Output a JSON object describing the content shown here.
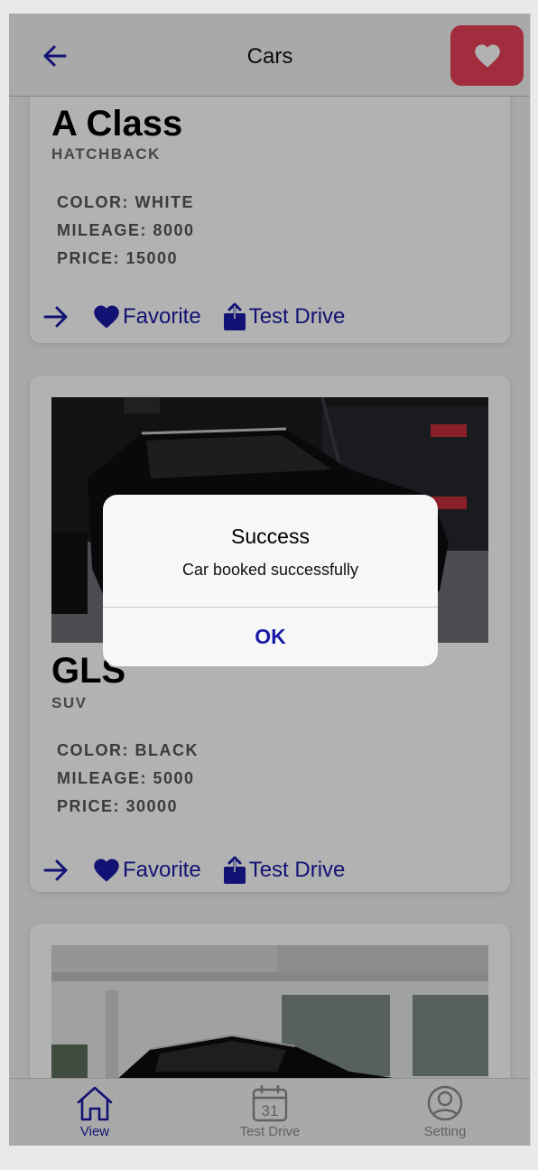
{
  "header": {
    "title": "Cars"
  },
  "cars": [
    {
      "name": "A Class",
      "type": "HATCHBACK",
      "specs": [
        "COLOR: WHITE",
        "MILEAGE: 8000",
        "PRICE: 15000"
      ]
    },
    {
      "name": "GLS",
      "type": "SUV",
      "specs": [
        "COLOR: BLACK",
        "MILEAGE: 5000",
        "PRICE: 30000"
      ]
    }
  ],
  "actions": {
    "favorite": "Favorite",
    "test_drive": "Test Drive"
  },
  "tabs": [
    {
      "label": "View",
      "icon": "home-icon",
      "active": true
    },
    {
      "label": "Test Drive",
      "icon": "calendar-icon",
      "calendar_day": "31",
      "active": false
    },
    {
      "label": "Setting",
      "icon": "profile-icon",
      "active": false
    }
  ],
  "alert": {
    "title": "Success",
    "message": "Car booked successfully",
    "ok_label": "OK"
  },
  "colors": {
    "accent": "#1a1aa6",
    "favorite_button": "#e8415a",
    "inactive_tab": "#8a8a8a"
  }
}
